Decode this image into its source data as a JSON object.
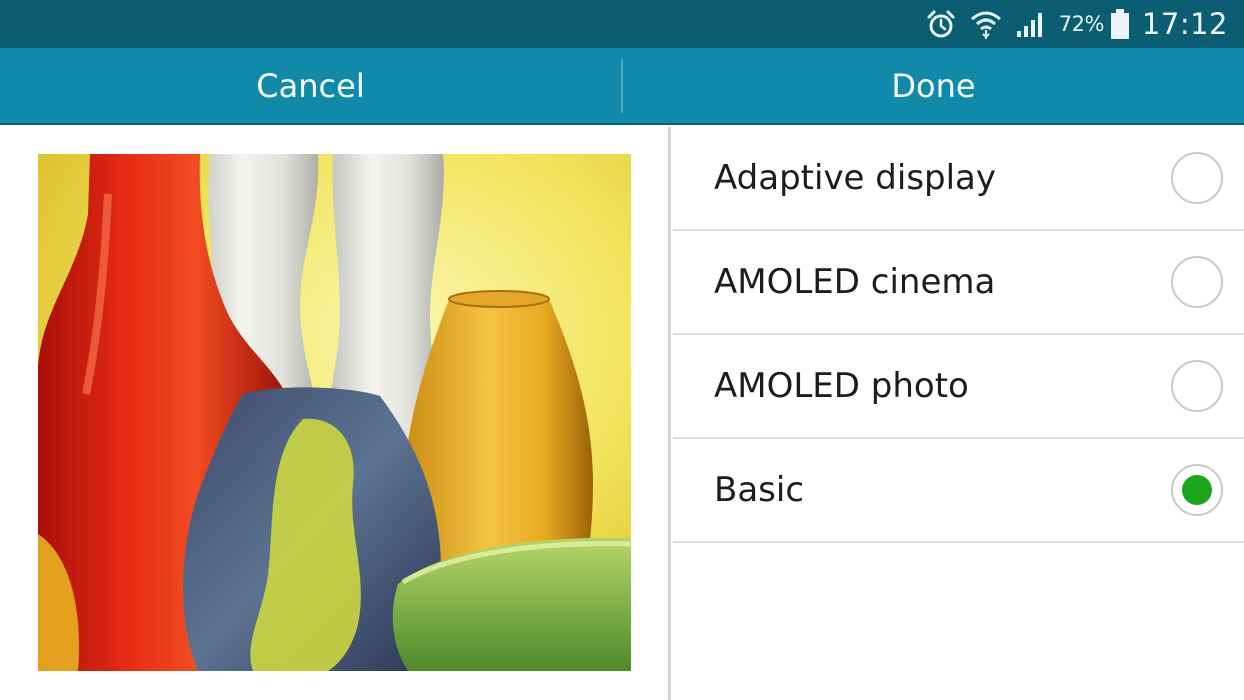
{
  "status_bar": {
    "icons": [
      "alarm-icon",
      "wifi-icon",
      "signal-icon",
      "battery-icon"
    ],
    "battery_percent": "72%",
    "time": "17:12"
  },
  "action_bar": {
    "cancel_label": "Cancel",
    "done_label": "Done"
  },
  "preview": {
    "subject": "colorful glass vases on a yellow background"
  },
  "options": [
    {
      "label": "Adaptive display",
      "selected": false
    },
    {
      "label": "AMOLED cinema",
      "selected": false
    },
    {
      "label": "AMOLED photo",
      "selected": false
    },
    {
      "label": "Basic",
      "selected": true
    }
  ],
  "colors": {
    "status_bar": "#0b5e72",
    "action_bar": "#108aa8",
    "radio_selected": "#1aa51a"
  }
}
